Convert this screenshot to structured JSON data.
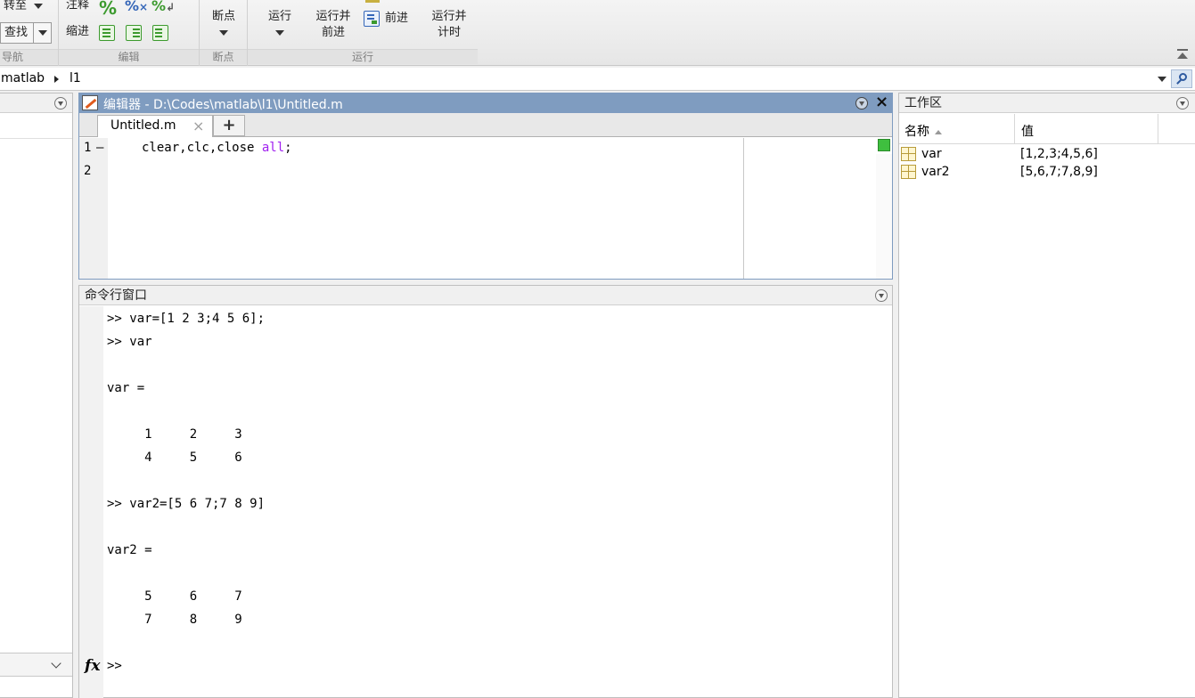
{
  "toolstrip": {
    "nav": {
      "goto_label": "转至",
      "find_label": "查找",
      "caption": "导航"
    },
    "edit": {
      "comment_label": "注释",
      "indent_label": "缩进",
      "caption": "编辑"
    },
    "breakpoints": {
      "label": "断点",
      "caption": "断点"
    },
    "run": {
      "run_label": "运行",
      "run_advance_label_1": "运行并",
      "run_advance_label_2": "前进",
      "advance_label": "前进",
      "run_time_label_1": "运行并",
      "run_time_label_2": "计时",
      "caption": "运行"
    },
    "colors": {
      "icon_green": "#3c9a2e",
      "icon_blue": "#3566b8"
    }
  },
  "address_bar": {
    "crumbs": [
      "matlab",
      "l1"
    ]
  },
  "editor": {
    "title": "编辑器 - D:\\Codes\\matlab\\l1\\Untitled.m",
    "tab_label": "Untitled.m",
    "add_tab_label": "+",
    "lines": [
      {
        "number": "1",
        "marker": "—",
        "code": "clear,clc,close ",
        "keyword": "all",
        "tail": ";"
      },
      {
        "number": "2",
        "marker": "",
        "code": "",
        "keyword": "",
        "tail": ""
      }
    ],
    "title_bar_color": "#7f9cc0",
    "string_color": "#a020f0",
    "status_indicator_color": "#3fbf3f"
  },
  "command_window": {
    "title": "命令行窗口",
    "lines": [
      ">> var=[1 2 3;4 5 6];",
      ">> var",
      "",
      "var =",
      "",
      "     1     2     3",
      "     4     5     6",
      "",
      ">> var2=[5 6 7;7 8 9]",
      "",
      "var2 =",
      "",
      "     5     6     7",
      "     7     8     9",
      "",
      ""
    ],
    "prompt": ">>",
    "fx_label": "fx"
  },
  "workspace": {
    "title": "工作区",
    "col_name": "名称",
    "col_value": "值",
    "variables": [
      {
        "name": "var",
        "value": "[1,2,3;4,5,6]"
      },
      {
        "name": "var2",
        "value": "[5,6,7;7,8,9]"
      }
    ]
  }
}
